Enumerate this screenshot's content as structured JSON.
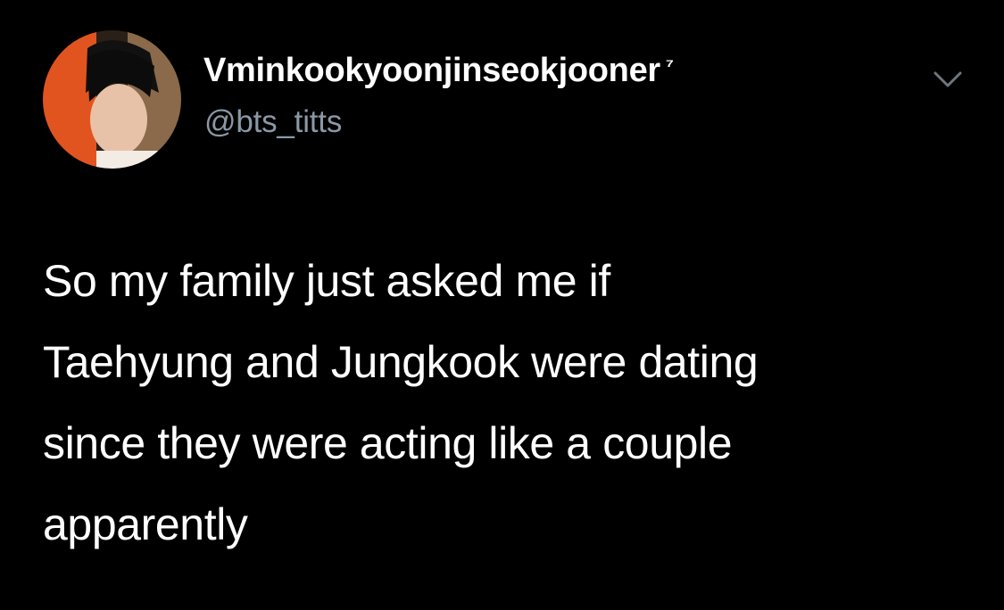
{
  "tweet": {
    "author": {
      "display_name": "Vminkookyoonjinseokjooner",
      "name_suffix": "⁷",
      "handle": "@bts_titts",
      "avatar_icon": "profile-photo"
    },
    "menu_icon": "chevron-down-icon",
    "text_lines": [
      "So my family just asked me if",
      "Taehyung and Jungkook were dating",
      "since they were acting like a couple",
      "apparently"
    ]
  },
  "colors": {
    "background": "#000000",
    "primary_text": "#ffffff",
    "secondary_text": "#8b98a5",
    "avatar_accent": "#e2541f"
  }
}
